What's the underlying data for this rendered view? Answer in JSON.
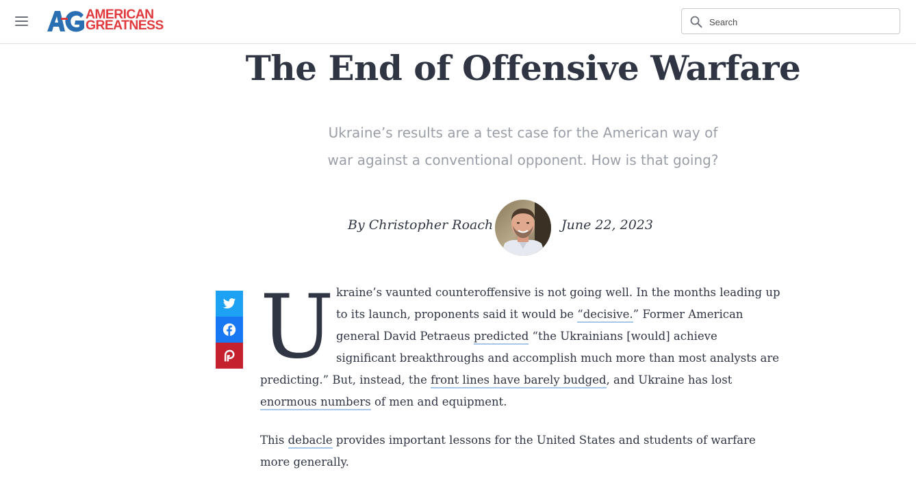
{
  "header": {
    "menu_icon": "hamburger-menu-icon",
    "logo": {
      "mark": "AG",
      "line1": "AMERICAN",
      "line2": "GREATNESS",
      "colors": {
        "mark": "#2a6fb2",
        "text": "#e03a3e"
      }
    },
    "search": {
      "placeholder": "Search",
      "value": "",
      "icon": "search-icon"
    }
  },
  "article": {
    "title": "The End of Offensive Warfare",
    "subtitle": "Ukraine’s results are a test case for the American way of war against a conventional opponent. How is that going?",
    "byline": "By Christopher Roach",
    "date": "June 22, 2023",
    "dropcap": "U",
    "p1": {
      "t1": "kraine’s vaunted counteroffensive is not going well. In the months leading up to its launch, proponents said it would be ",
      "l1": "“decisive.",
      "t2": "” Former American general David Petraeus ",
      "l2": "predicted",
      "t3": " “the Ukrainians [would] achieve significant breakthroughs and accomplish much more than most analysts are predicting.” But, instead, the ",
      "l3": "front lines have barely budged",
      "t4": ", and Ukraine has lost ",
      "l4": "enormous numbers",
      "t5": " of men and equipment."
    },
    "p2": {
      "t1": "This ",
      "l1": "debacle",
      "t2": " provides important lessons for the United States and students of warfare more generally."
    }
  },
  "share": [
    {
      "network": "twitter",
      "icon": "twitter-icon",
      "color": "#1da1f2"
    },
    {
      "network": "facebook",
      "icon": "facebook-icon",
      "color": "#1877f2"
    },
    {
      "network": "parler",
      "icon": "parler-icon",
      "color": "#c4202e"
    }
  ]
}
